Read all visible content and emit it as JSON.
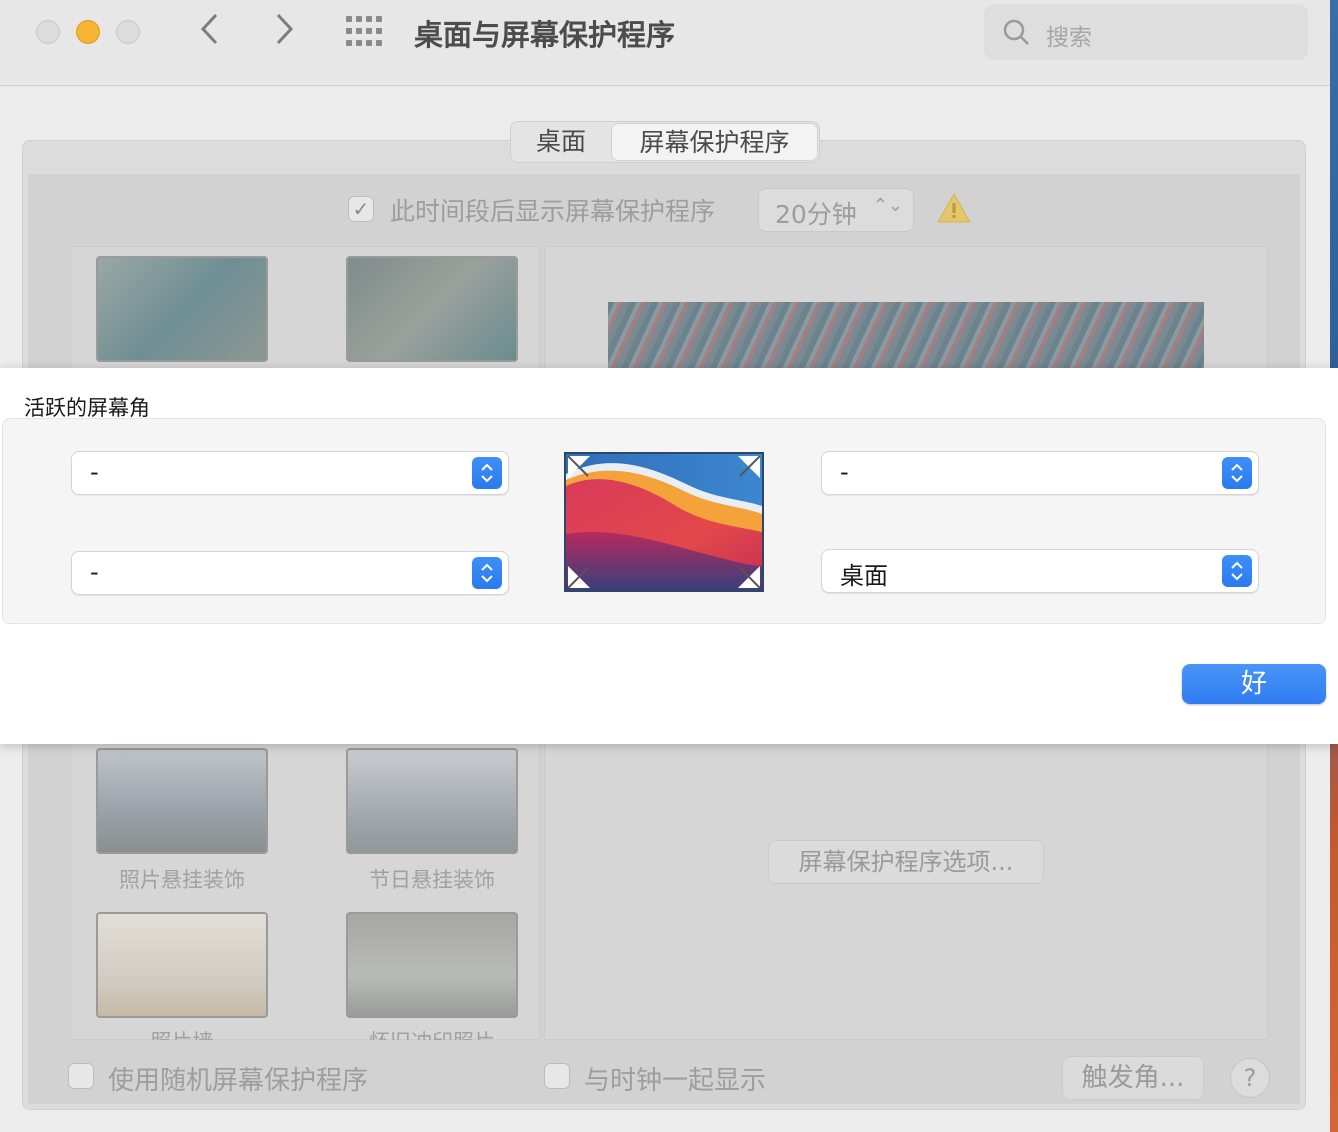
{
  "window": {
    "title": "桌面与屏幕保护程序",
    "search_placeholder": "搜索"
  },
  "tabs": [
    {
      "label": "桌面",
      "selected": false
    },
    {
      "label": "屏幕保护程序",
      "selected": true
    }
  ],
  "options": {
    "show_after_label": "此时间段后显示屏幕保护程序",
    "show_after_checked": true,
    "time_value": "20分钟",
    "time_stepper_glyph": "⌃⌄"
  },
  "thumbnails": [
    {
      "label": "照片悬挂装饰"
    },
    {
      "label": "节日悬挂装饰"
    },
    {
      "label": "照片墙"
    },
    {
      "label": "怀旧冲印照片"
    }
  ],
  "screen_saver_options_label": "屏幕保护程序选项...",
  "bottom": {
    "random_label": "使用随机屏幕保护程序",
    "clock_label": "与时钟一起显示",
    "hot_corners_label": "触发角...",
    "help_label": "?"
  },
  "sheet": {
    "title": "活跃的屏幕角",
    "top_left": "-",
    "top_right": "-",
    "bottom_left": "-",
    "bottom_right": "桌面",
    "ok_label": "好"
  },
  "colors": {
    "accent": "#2f7cf1",
    "minimize": "#f6b434"
  }
}
